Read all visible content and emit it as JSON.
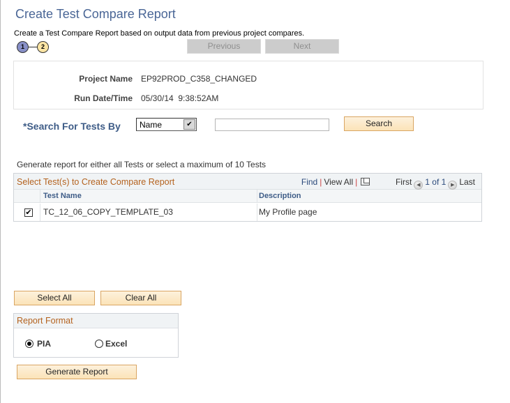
{
  "page": {
    "title": "Create Test Compare Report",
    "subtitle": "Create a Test Compare Report based on output data from previous project compares."
  },
  "steps": [
    {
      "number": "1",
      "state": "current"
    },
    {
      "number": "2",
      "state": "next"
    }
  ],
  "nav": {
    "previous_label": "Previous",
    "next_label": "Next"
  },
  "info": {
    "project_name_label": "Project Name",
    "project_name_value": "EP92PROD_C358_CHANGED",
    "run_datetime_label": "Run Date/Time",
    "run_datetime_value": "05/30/14  9:38:52AM"
  },
  "search": {
    "label": "*Search For Tests By",
    "select_value": "Name",
    "input_value": "",
    "button_label": "Search"
  },
  "note": "Generate report for either all Tests or select a maximum of 10 Tests",
  "grid": {
    "title": "Select Test(s) to Create Compare Report",
    "find_label": "Find",
    "view_all_label": "View All",
    "separator": "|",
    "first_label": "First",
    "page_info": "1 of 1",
    "last_label": "Last",
    "columns": [
      "",
      "Test Name",
      "Description"
    ],
    "rows": [
      {
        "checked": true,
        "test_name": "TC_12_06_COPY_TEMPLATE_03",
        "description": "My Profile page"
      }
    ]
  },
  "actions": {
    "select_all_label": "Select All",
    "clear_all_label": "Clear All"
  },
  "report_format": {
    "title": "Report Format",
    "options": [
      {
        "label": "PIA",
        "selected": true
      },
      {
        "label": "Excel",
        "selected": false
      }
    ]
  },
  "generate_label": "Generate Report",
  "colors": {
    "title_blue": "#4a6696",
    "section_orange": "#b4621e",
    "button_bg": "#fbe3b8",
    "button_border": "#d9a562"
  }
}
